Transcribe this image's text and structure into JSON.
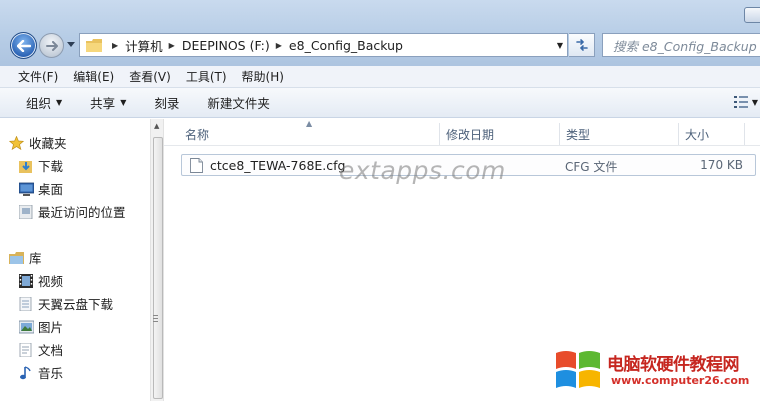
{
  "address": {
    "crumbs": [
      "计算机",
      "DEEPINOS (F:)",
      "e8_Config_Backup"
    ]
  },
  "search": {
    "placeholder": "搜索 e8_Config_Backup"
  },
  "menu": [
    "文件(F)",
    "编辑(E)",
    "查看(V)",
    "工具(T)",
    "帮助(H)"
  ],
  "commands": {
    "organize": "组织",
    "share": "共享",
    "burn": "刻录",
    "new_folder": "新建文件夹"
  },
  "sidebar": {
    "favorites": {
      "label": "收藏夹",
      "items": [
        "下载",
        "桌面",
        "最近访问的位置"
      ]
    },
    "libraries": {
      "label": "库",
      "items": [
        "视频",
        "天翼云盘下载",
        "图片",
        "文档",
        "音乐"
      ]
    }
  },
  "columns": {
    "name": "名称",
    "modified": "修改日期",
    "type": "类型",
    "size": "大小"
  },
  "files": [
    {
      "name": "ctce8_TEWA-768E.cfg",
      "type": "CFG 文件",
      "size": "170 KB"
    }
  ],
  "watermark": "extapps.com",
  "logo": {
    "title": "电脑软硬件教程网",
    "url": "www.computer26.com"
  },
  "colors": {
    "accent_blue": "#2b63b5",
    "logo_red": "#c6261f"
  }
}
